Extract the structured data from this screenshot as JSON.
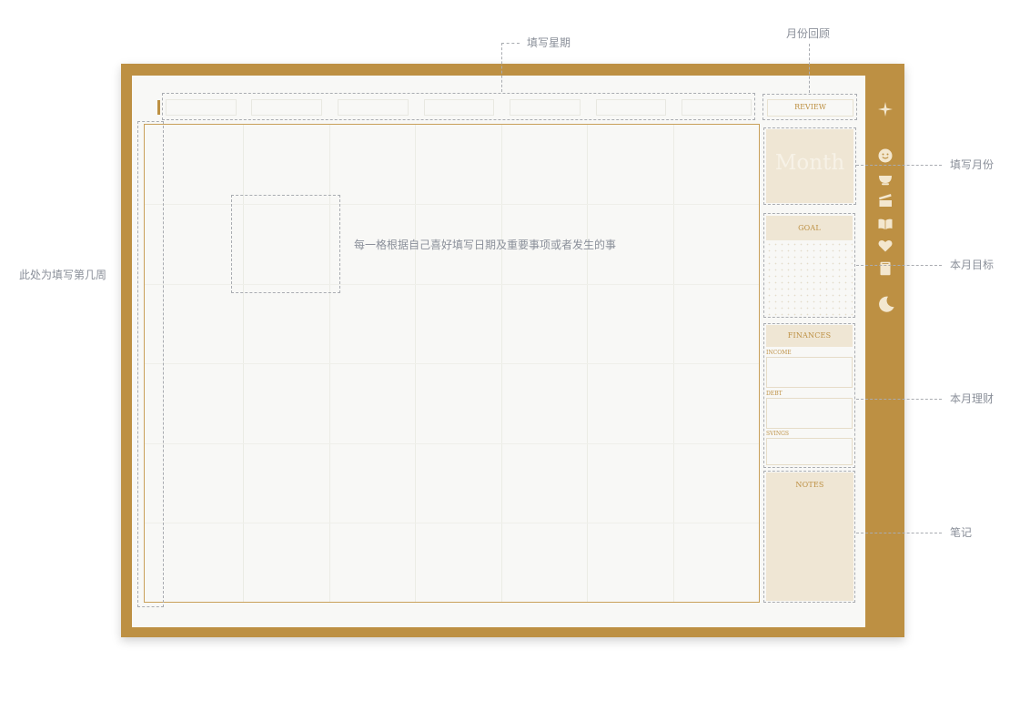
{
  "annotations": {
    "weekday": "填写星期",
    "review": "月份回顾",
    "week_number": "此处为填写第几周",
    "month": "填写月份",
    "goal": "本月目标",
    "finance": "本月理财",
    "notes": "笔记",
    "cell_hint": "每一格根据自己喜好填写日期及重要事项或者发生的事"
  },
  "planner": {
    "review_label": "REVIEW",
    "month_label": "Month",
    "goal_label": "GOAL",
    "finances_label": "FINANCES",
    "income_label": "INCOME",
    "debt_label": "DEBT",
    "savings_label": "SVINGS",
    "notes_label": "NOTES",
    "weekdays": [
      "",
      "",
      "",
      "",
      "",
      "",
      ""
    ]
  },
  "sidebar_icons": [
    "sparkle-icon",
    "smiley-icon",
    "bowl-icon",
    "clapper-icon",
    "book-icon",
    "heart-icon",
    "notepad-icon",
    "moon-icon"
  ],
  "colors": {
    "frame": "#bd9043",
    "paper": "#f8f8f6",
    "card": "#efe6d4",
    "icon": "#f3e7cf",
    "annotation": "#8a8f99"
  }
}
